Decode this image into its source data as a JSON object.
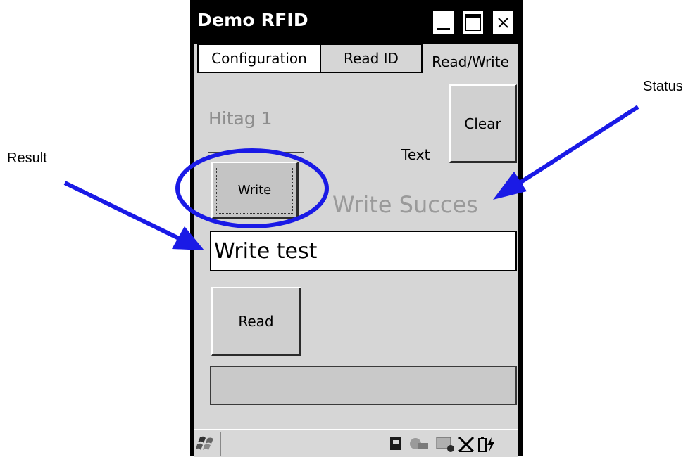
{
  "window": {
    "title": "Demo RFID"
  },
  "tabs": [
    {
      "label": "Configuration"
    },
    {
      "label": "Read ID"
    },
    {
      "label": "Read/Write"
    }
  ],
  "form": {
    "tag_type": "Hitag 1",
    "clear_label": "Clear",
    "text_label": "Text",
    "write_label": "Write",
    "status": "Write Succes",
    "result_value": "Write test",
    "read_label": "Read",
    "read_output": ""
  },
  "annotations": {
    "status": "Status",
    "result": "Result"
  },
  "colors": {
    "annotation_blue": "#1a1ae6",
    "titlebar": "#000000",
    "screen": "#d6d6d6"
  }
}
